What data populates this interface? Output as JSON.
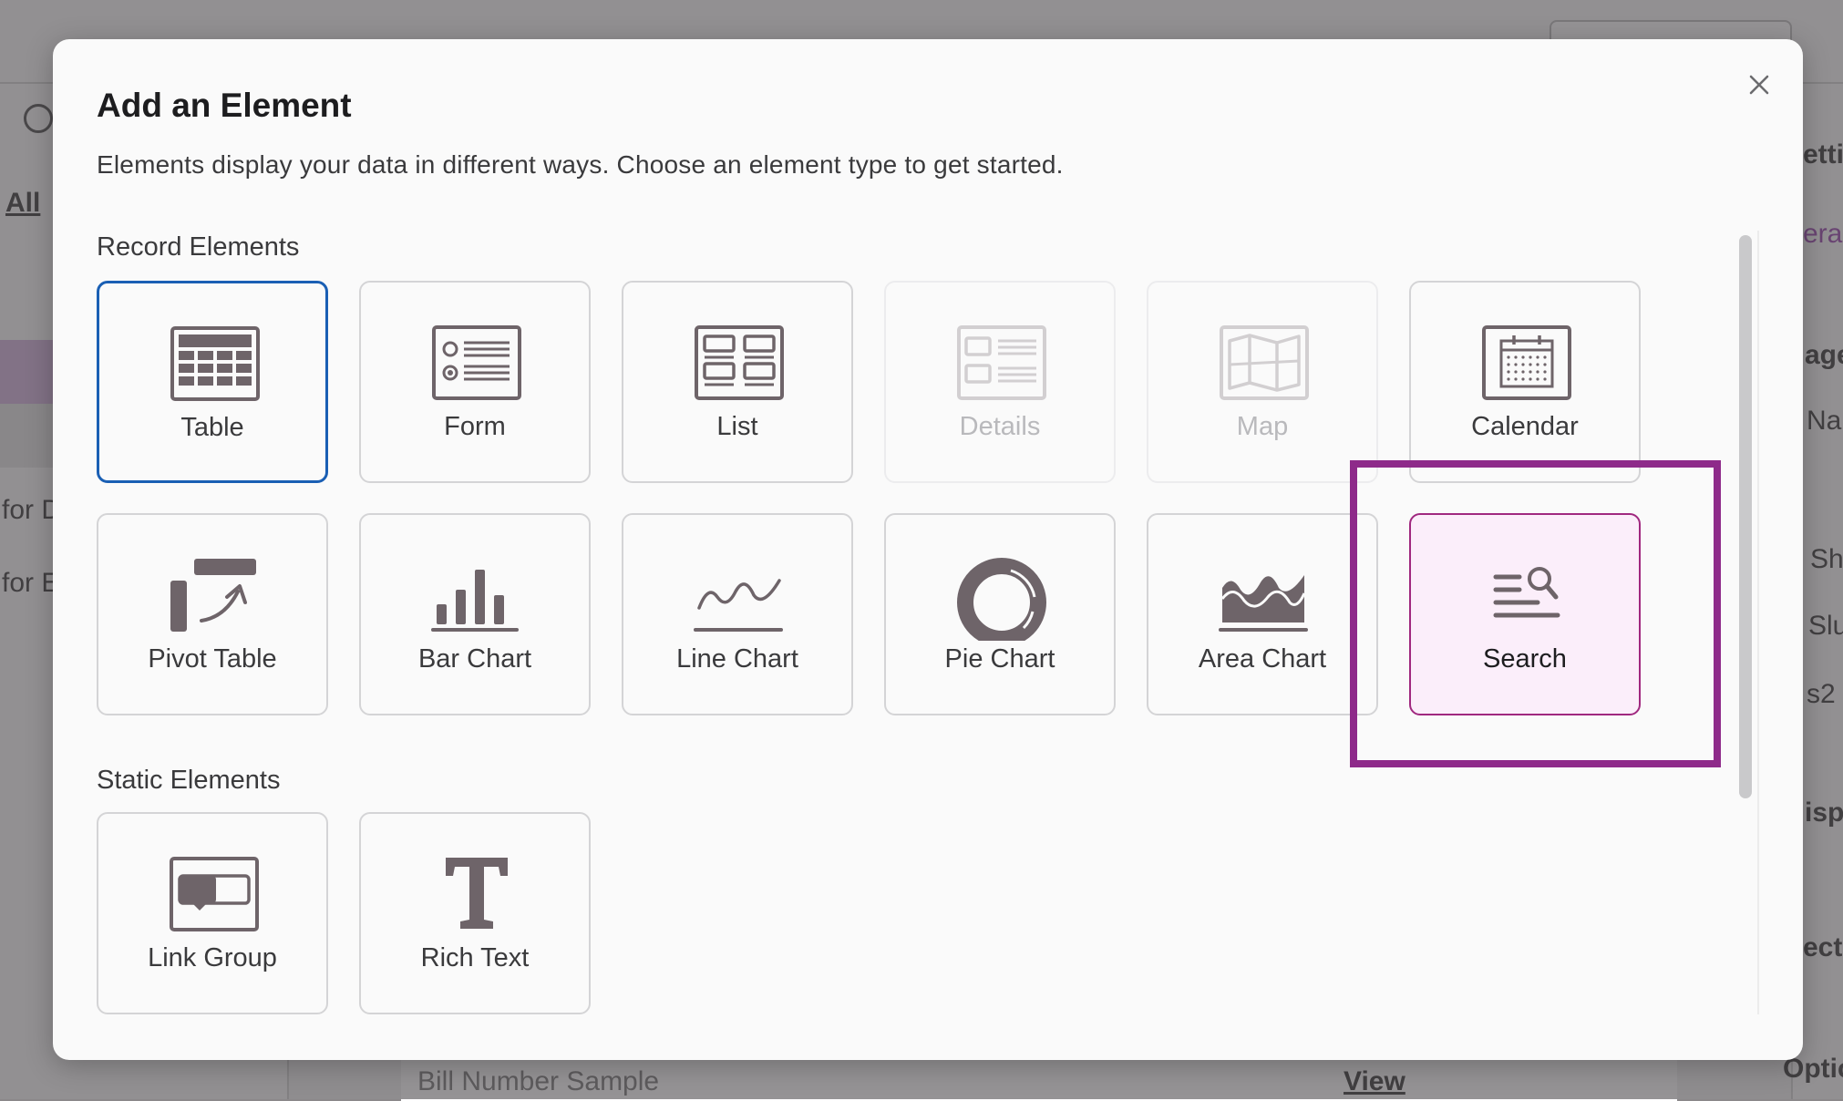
{
  "background": {
    "tab_all": "All",
    "row_label_1": "for D",
    "row_label_2": "for E",
    "right_snippets": [
      "etti",
      "eral",
      "age",
      "Na",
      "Sh",
      "Slu",
      "s2",
      "ispl",
      "ect",
      "Optic"
    ],
    "bottom_sample": "Bill Number Sample",
    "bottom_view": "View"
  },
  "modal": {
    "title": "Add an Element",
    "description": "Elements display your data in different ways. Choose an element type to get started.",
    "close_label": "×",
    "record_heading": "Record Elements",
    "static_heading": "Static Elements",
    "record_elements": [
      {
        "label": "Table",
        "icon": "table-icon",
        "state": "selected"
      },
      {
        "label": "Form",
        "icon": "form-icon",
        "state": "enabled"
      },
      {
        "label": "List",
        "icon": "list-icon",
        "state": "enabled"
      },
      {
        "label": "Details",
        "icon": "details-icon",
        "state": "disabled"
      },
      {
        "label": "Map",
        "icon": "map-icon",
        "state": "disabled"
      },
      {
        "label": "Calendar",
        "icon": "calendar-icon",
        "state": "enabled"
      },
      {
        "label": "Pivot Table",
        "icon": "pivot-table-icon",
        "state": "enabled"
      },
      {
        "label": "Bar Chart",
        "icon": "bar-chart-icon",
        "state": "enabled"
      },
      {
        "label": "Line Chart",
        "icon": "line-chart-icon",
        "state": "enabled"
      },
      {
        "label": "Pie Chart",
        "icon": "pie-chart-icon",
        "state": "enabled"
      },
      {
        "label": "Area Chart",
        "icon": "area-chart-icon",
        "state": "enabled"
      },
      {
        "label": "Search",
        "icon": "search-icon",
        "state": "highlighted"
      }
    ],
    "static_elements": [
      {
        "label": "Link Group",
        "icon": "link-group-icon",
        "state": "enabled"
      },
      {
        "label": "Rich Text",
        "icon": "rich-text-icon",
        "state": "enabled"
      }
    ]
  },
  "colors": {
    "selected_border": "#1a5fb4",
    "highlight_frame": "#8e2a8a",
    "search_tile_bg": "#fbeefa",
    "icon_color": "#6e6469"
  }
}
